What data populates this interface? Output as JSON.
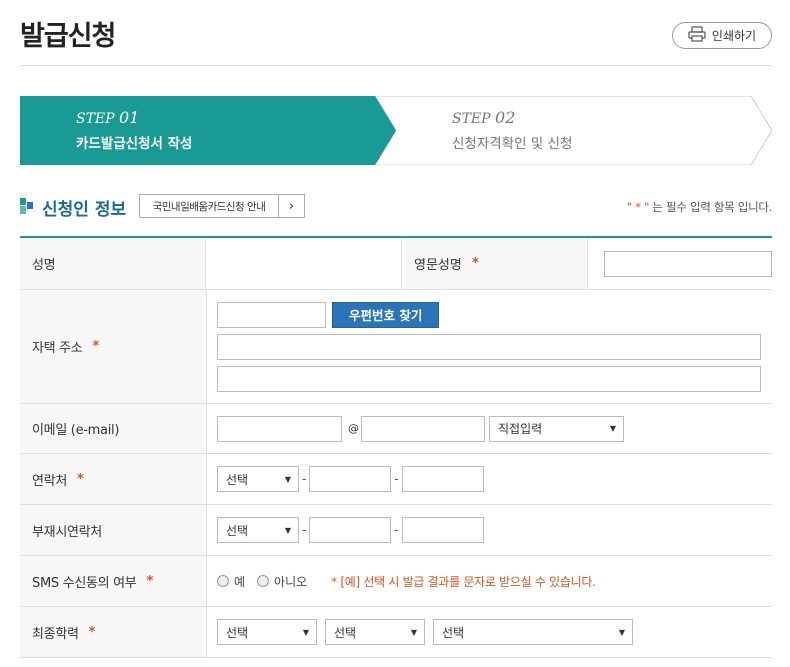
{
  "page": {
    "title": "발급신청",
    "print_label": "인쇄하기"
  },
  "steps": [
    {
      "prefix": "STEP",
      "num": "01",
      "label": "카드발급신청서 작성",
      "active": true
    },
    {
      "prefix": "STEP",
      "num": "02",
      "label": "신청자격확인 및 신청",
      "active": false
    }
  ],
  "section": {
    "title": "신청인 정보",
    "guide_label": "국민내일배움카드신청 안내",
    "req_quote_open": "\" * \"",
    "req_text": " 는 필수 입력 항목 입니다."
  },
  "colors": {
    "accent": "#1a9a94",
    "title": "#1a6c8b",
    "required": "#d9531e",
    "button": "#2c74b8"
  },
  "form": {
    "name_label": "성명",
    "eng_name_label": "영문성명",
    "address_label": "자택 주소",
    "zip_button": "우편번호 찾기",
    "email_label": "이메일 (e-mail)",
    "email_at": "@",
    "email_domain_select": "직접입력",
    "phone_label": "연락처",
    "absent_phone_label": "부재시연락처",
    "select_placeholder": "선택",
    "sms_label": "SMS 수신동의 여부",
    "sms_yes": "예",
    "sms_no": "아니오",
    "sms_note": "* [예] 선택 시 발급 결과를 문자로 받으실 수 있습니다.",
    "edu_label": "최종학력",
    "required_mark": "*"
  }
}
